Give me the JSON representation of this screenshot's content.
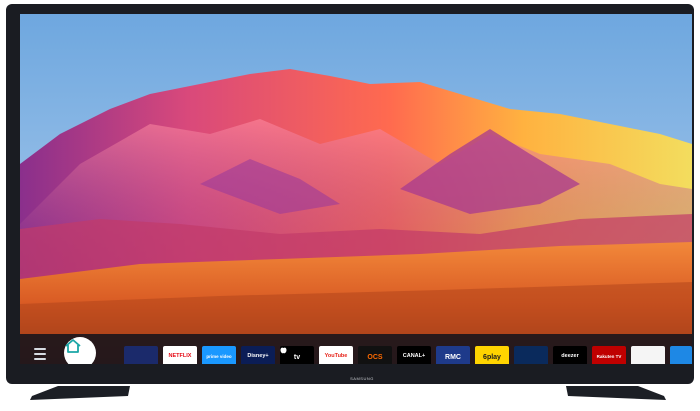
{
  "tv": {
    "brand": "SAMSUNG"
  },
  "smart_hub": {
    "menu_icon": "menu-icon",
    "home_icon": "home-icon",
    "apps": [
      {
        "label": "",
        "bg": "#1b2a6b",
        "fg": "#ffffff",
        "icon": "tile-icon"
      },
      {
        "label": "NETFLIX",
        "bg": "#ffffff",
        "fg": "#e50914"
      },
      {
        "label": "prime video",
        "bg": "#1a98ff",
        "fg": "#ffffff"
      },
      {
        "label": "Disney+",
        "bg": "#0b1d56",
        "fg": "#ffffff"
      },
      {
        "label": "tv",
        "bg": "#000000",
        "fg": "#ffffff",
        "icon": "apple-icon"
      },
      {
        "label": "YouTube",
        "bg": "#ffffff",
        "fg": "#e62117"
      },
      {
        "label": "OCS",
        "bg": "#111111",
        "fg": "#ff6a00"
      },
      {
        "label": "CANAL+",
        "bg": "#000000",
        "fg": "#ffffff"
      },
      {
        "label": "RMC",
        "bg": "#1e3a8a",
        "fg": "#ffffff"
      },
      {
        "label": "6play",
        "bg": "#ffd400",
        "fg": "#1b1b1b"
      },
      {
        "label": "",
        "bg": "#0a2a5c",
        "fg": "#ffffff",
        "icon": "tile-icon"
      },
      {
        "label": "deezer",
        "bg": "#000000",
        "fg": "#ffffff"
      },
      {
        "label": "Rakuten TV",
        "bg": "#bf0000",
        "fg": "#ffffff"
      },
      {
        "label": "",
        "bg": "#f5f5f5",
        "fg": "#2a8fd7",
        "icon": "tile-icon"
      },
      {
        "label": "",
        "bg": "#1e88e5",
        "fg": "#ffffff",
        "icon": "tile-icon"
      }
    ]
  }
}
